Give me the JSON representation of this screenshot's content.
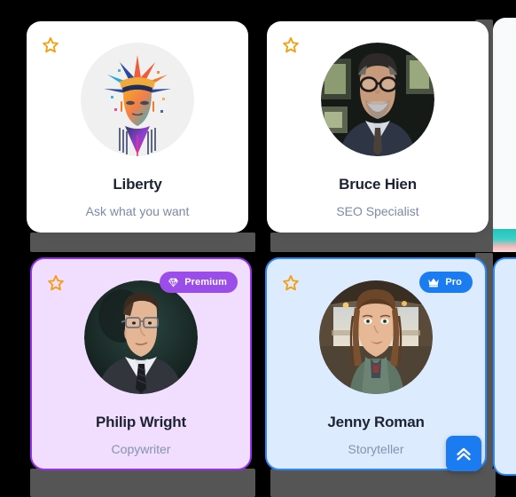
{
  "theme": {
    "page_background": "#000000",
    "shadow_color": "#555555",
    "star_color": "#f59e0b",
    "name_color": "#1c2434",
    "role_color": "#7a8aa8",
    "premium_accent": "#9b4dea",
    "premium_card_background": "#f1ddfd",
    "premium_card_border": "#9333ea",
    "pro_accent": "#1a7cf0",
    "pro_card_background": "#dcebfe",
    "pro_card_border": "#2f86f6",
    "plain_card_background": "#ffffff"
  },
  "cards": [
    {
      "id": "liberty",
      "name": "Liberty",
      "role": "Ask what you want",
      "favorite_icon": "star-icon",
      "favorited": false,
      "badge": null,
      "avatar_kind": "illustration-statue-of-liberty",
      "style": "plain"
    },
    {
      "id": "bruce-hien",
      "name": "Bruce Hien",
      "role": "SEO Specialist",
      "favorite_icon": "star-icon",
      "favorited": false,
      "badge": null,
      "avatar_kind": "photo-man-glasses-suit",
      "style": "plain"
    },
    {
      "id": "philip-wright",
      "name": "Philip Wright",
      "role": "Copywriter",
      "favorite_icon": "star-icon",
      "favorited": false,
      "badge": {
        "label": "Premium",
        "icon": "gem-icon",
        "color": "#9b4dea"
      },
      "avatar_kind": "photo-young-man-suit-dark",
      "style": "premium"
    },
    {
      "id": "jenny-roman",
      "name": "Jenny Roman",
      "role": "Storyteller",
      "favorite_icon": "star-icon",
      "favorited": false,
      "badge": {
        "label": "Pro",
        "icon": "crown-icon",
        "color": "#1a7cf0"
      },
      "avatar_kind": "photo-woman-braids-van",
      "style": "pro"
    }
  ],
  "scroll_top_button": {
    "icon": "double-chevron-up-icon",
    "label": "",
    "color": "#1a7cf0"
  }
}
